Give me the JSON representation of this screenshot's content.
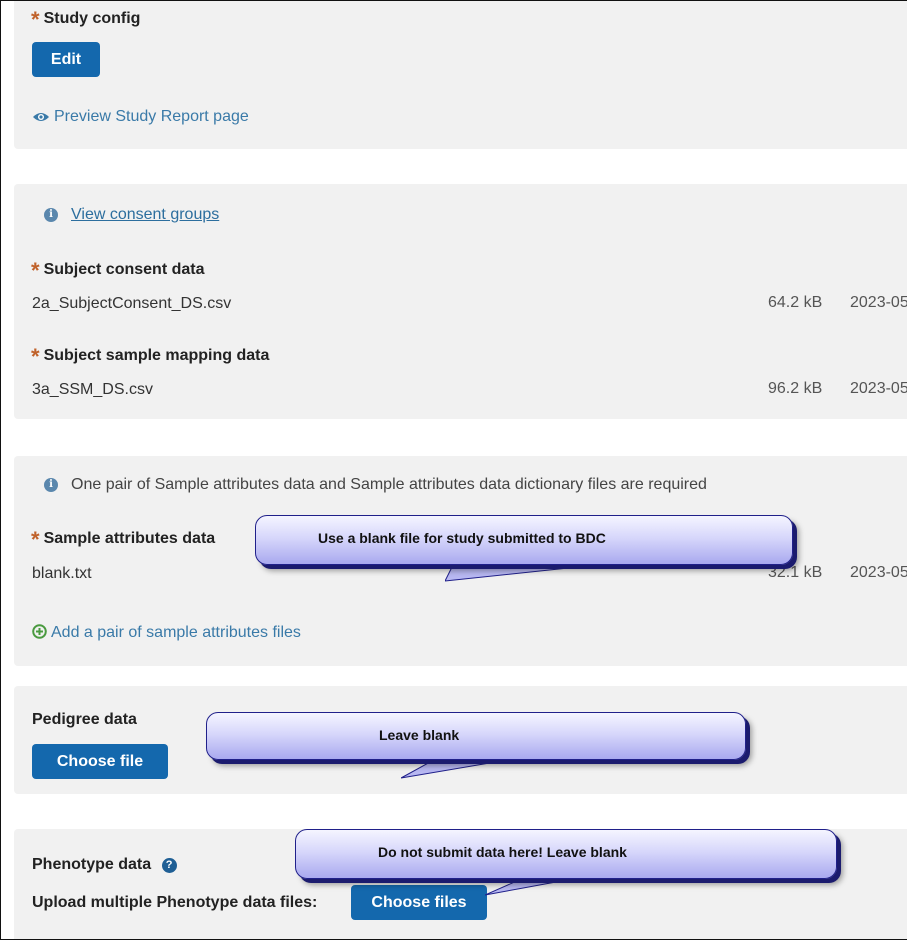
{
  "study_config": {
    "label": "Study config",
    "edit_button": "Edit",
    "preview_link": "Preview Study Report page"
  },
  "consent_panel": {
    "info_link": "View consent groups",
    "subject_consent_label": "Subject consent data",
    "subject_consent_file": "2a_SubjectConsent_DS.csv",
    "subject_consent_size": "64.2 kB",
    "subject_consent_date": "2023-05",
    "sample_mapping_label": "Subject sample mapping data",
    "sample_mapping_file": "3a_SSM_DS.csv",
    "sample_mapping_size": "96.2 kB",
    "sample_mapping_date": "2023-05"
  },
  "sample_attr_panel": {
    "info_text": "One pair of Sample attributes data and Sample attributes data dictionary files are required",
    "label": "Sample attributes data",
    "file": "blank.txt",
    "size": "32.1 kB",
    "date": "2023-05",
    "add_link": "Add a pair of sample attributes files",
    "callout": "Use a blank file for study submitted to BDC"
  },
  "pedigree_panel": {
    "label": "Pedigree data",
    "choose_button": "Choose file",
    "callout": "Leave blank"
  },
  "phenotype_panel": {
    "label": "Phenotype data",
    "upload_label": "Upload multiple Phenotype data files:",
    "choose_button": "Choose files",
    "callout": "Do not submit data here!  Leave blank"
  },
  "colors": {
    "accent_button": "#1468ad",
    "required_star": "#c0622b",
    "link": "#3a7aa8",
    "panel_bg": "#f1f1f1",
    "add_icon": "#4a9a3f"
  },
  "icons": [
    "required-star-icon",
    "eye-icon",
    "info-icon",
    "plus-circle-icon",
    "help-icon"
  ]
}
